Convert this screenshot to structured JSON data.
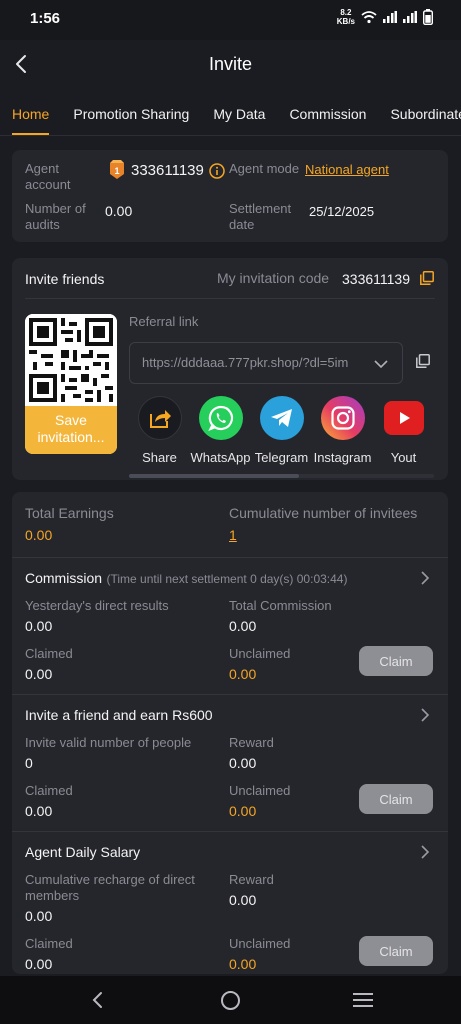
{
  "status": {
    "time": "1:56",
    "speed_value": "8.2",
    "speed_unit": "KB/s"
  },
  "header": {
    "title": "Invite"
  },
  "tabs": [
    "Home",
    "Promotion Sharing",
    "My Data",
    "Commission",
    "Subordinate"
  ],
  "agent": {
    "account_label": "Agent account",
    "account_value": "333611139",
    "mode_label": "Agent mode",
    "mode_value": "National agent",
    "audits_label": "Number of audits",
    "audits_value": "0.00",
    "settlement_label": "Settlement date",
    "settlement_value": "25/12/2025"
  },
  "invite": {
    "title": "Invite friends",
    "code_label": "My invitation code",
    "code_value": "333611139",
    "referral_label": "Referral link",
    "referral_value": "https://dddaaa.777pkr.shop/?dl=5im",
    "save_button": "Save invitation...",
    "share_items": [
      {
        "label": "Share",
        "icon": "share-icon"
      },
      {
        "label": "WhatsApp",
        "icon": "whatsapp-icon"
      },
      {
        "label": "Telegram",
        "icon": "telegram-icon"
      },
      {
        "label": "Instagram",
        "icon": "instagram-icon"
      },
      {
        "label": "Yout",
        "icon": "youtube-icon"
      }
    ]
  },
  "earnings": {
    "total_label": "Total Earnings",
    "total_value": "0.00",
    "invitees_label": "Cumulative number of invitees",
    "invitees_value": "1"
  },
  "commission": {
    "title": "Commission",
    "note": "(Time until next settlement 0 day(s) 00:03:44)",
    "direct_label": "Yesterday's direct results",
    "direct_value": "0.00",
    "total_label": "Total Commission",
    "total_value": "0.00",
    "claimed_label": "Claimed",
    "claimed_value": "0.00",
    "unclaimed_label": "Unclaimed",
    "unclaimed_value": "0.00",
    "claim_button": "Claim"
  },
  "friend": {
    "title": "Invite a friend and earn Rs600",
    "valid_label": "Invite valid number of people",
    "valid_value": "0",
    "reward_label": "Reward",
    "reward_value": "0.00",
    "claimed_label": "Claimed",
    "claimed_value": "0.00",
    "unclaimed_label": "Unclaimed",
    "unclaimed_value": "0.00",
    "claim_button": "Claim"
  },
  "salary": {
    "title": "Agent Daily Salary",
    "recharge_label": "Cumulative recharge of direct members",
    "recharge_value": "0.00",
    "reward_label": "Reward",
    "reward_value": "0.00",
    "claimed_label": "Claimed",
    "claimed_value": "0.00",
    "unclaimed_label": "Unclaimed",
    "unclaimed_value": "0.00",
    "claim_button": "Claim"
  },
  "colors": {
    "accent": "#f5a623",
    "background": "#1b1c21",
    "card": "#25262c"
  }
}
